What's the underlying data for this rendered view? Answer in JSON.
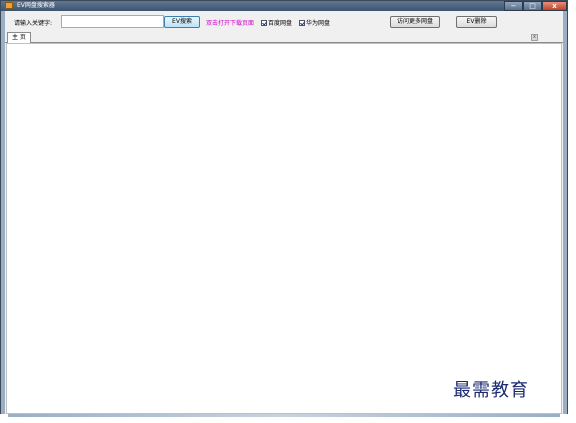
{
  "window": {
    "title": "EV网盘搜索器",
    "minimize": "−",
    "maximize": "□",
    "close": "x"
  },
  "toolbar": {
    "keyword_label": "请输入关键字:",
    "keyword_value": "",
    "search_button": "EV搜索",
    "open_download_link": "双击打开下载页面",
    "baidu_checkbox": "百度网盘",
    "huawei_checkbox": "华为网盘",
    "more_button": "访问更多网盘",
    "delete_button": "EV删除"
  },
  "tabs": {
    "home": "主 页",
    "close": "x"
  },
  "watermark": "最需教育",
  "colors": {
    "titlebar": "#4a627d",
    "link": "#cc00cc",
    "close_button": "#c34127"
  }
}
